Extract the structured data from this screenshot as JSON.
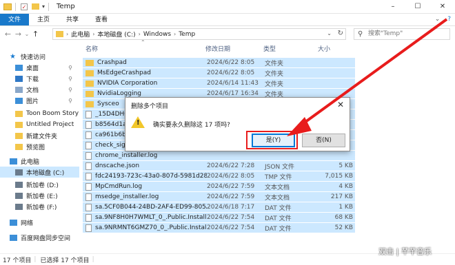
{
  "window": {
    "title": "Temp",
    "minimize": "–",
    "maximize": "☐",
    "close": "✕"
  },
  "ribbon": {
    "tabs": [
      "文件",
      "主页",
      "共享",
      "查看"
    ],
    "expand": "⌄",
    "help": "?"
  },
  "address": {
    "crumbs": [
      "此电脑",
      "本地磁盘 (C:)",
      "Windows",
      "Temp"
    ],
    "search_placeholder": "搜索\"Temp\""
  },
  "sidebar": {
    "items": [
      {
        "label": "快速访问",
        "icon": "star-icon",
        "color": "#1a7cd1"
      },
      {
        "label": "桌面",
        "icon": "desktop-icon",
        "color": "#3c8fd8",
        "pinned": true
      },
      {
        "label": "下载",
        "icon": "download-icon",
        "color": "#2f78c6",
        "pinned": true
      },
      {
        "label": "文档",
        "icon": "document-icon",
        "color": "#8aa7c9",
        "pinned": true
      },
      {
        "label": "图片",
        "icon": "picture-icon",
        "color": "#3c8fd8",
        "pinned": true
      },
      {
        "label": "Toon Boom Story",
        "icon": "folder-icon",
        "color": "#f3c64a"
      },
      {
        "label": "Untitled Project",
        "icon": "folder-icon",
        "color": "#f3c64a"
      },
      {
        "label": "新建文件夹",
        "icon": "folder-icon",
        "color": "#f3c64a"
      },
      {
        "label": "预览图",
        "icon": "folder-icon",
        "color": "#f3c64a"
      },
      {
        "label": "此电脑",
        "icon": "computer-icon",
        "color": "#3c8fd8"
      },
      {
        "label": "本地磁盘 (C:)",
        "icon": "drive-icon",
        "color": "#6b7b8c",
        "selected": true
      },
      {
        "label": "新加卷 (D:)",
        "icon": "drive-icon",
        "color": "#6b7b8c"
      },
      {
        "label": "新加卷 (E:)",
        "icon": "drive-icon",
        "color": "#6b7b8c"
      },
      {
        "label": "新加卷 (F:)",
        "icon": "drive-icon",
        "color": "#6b7b8c"
      },
      {
        "label": "网络",
        "icon": "network-icon",
        "color": "#3c8fd8"
      },
      {
        "label": "百度网盘同步空间",
        "icon": "cloud-icon",
        "color": "#3c8fd8"
      }
    ]
  },
  "columns": {
    "name": "名称",
    "date": "修改日期",
    "type": "类型",
    "size": "大小"
  },
  "files": [
    {
      "name": "Crashpad",
      "date": "2024/6/22 8:05",
      "type": "文件夹",
      "size": "",
      "kind": "folder"
    },
    {
      "name": "MsEdgeCrashpad",
      "date": "2024/6/22 8:05",
      "type": "文件夹",
      "size": "",
      "kind": "folder"
    },
    {
      "name": "NVIDIA Corporation",
      "date": "2024/6/14 11:43",
      "type": "文件夹",
      "size": "",
      "kind": "folder"
    },
    {
      "name": "NvidiaLogging",
      "date": "2024/6/17 16:34",
      "type": "文件夹",
      "size": "",
      "kind": "folder"
    },
    {
      "name": "Sysceo",
      "date": "",
      "type": "",
      "size": "",
      "kind": "folder"
    },
    {
      "name": "_15D4DHG",
      "date": "",
      "type": "",
      "size": "",
      "kind": "file"
    },
    {
      "name": "b8564d1a-",
      "date": "",
      "type": "",
      "size": "",
      "kind": "file"
    },
    {
      "name": "ca961b6b-",
      "date": "",
      "type": "",
      "size": "",
      "kind": "file"
    },
    {
      "name": "check_sign",
      "date": "",
      "type": "",
      "size": "",
      "kind": "file"
    },
    {
      "name": "chrome_installer.log",
      "date": "",
      "type": "",
      "size": "",
      "kind": "file"
    },
    {
      "name": "dnscache.json",
      "date": "2024/6/22 7:28",
      "type": "JSON 文件",
      "size": "5 KB",
      "kind": "file"
    },
    {
      "name": "fdc24193-723c-43a0-807d-5981d287...",
      "date": "2024/6/22 8:05",
      "type": "TMP 文件",
      "size": "7,015 KB",
      "kind": "file"
    },
    {
      "name": "MpCmdRun.log",
      "date": "2024/6/22 7:59",
      "type": "文本文档",
      "size": "4 KB",
      "kind": "file"
    },
    {
      "name": "msedge_installer.log",
      "date": "2024/6/22 7:59",
      "type": "文本文档",
      "size": "217 KB",
      "kind": "file"
    },
    {
      "name": "sa.5CF0B044-24BD-2AF4-ED99-805A...",
      "date": "2024/6/18 7:17",
      "type": "DAT 文件",
      "size": "1 KB",
      "kind": "file"
    },
    {
      "name": "sa.9NF8H0H7WMLT_0_.Public.Install...",
      "date": "2024/6/22 7:54",
      "type": "DAT 文件",
      "size": "68 KB",
      "kind": "file"
    },
    {
      "name": "sa.9NRMNT6GMZ70_0_.Public.Install...",
      "date": "2024/6/22 7:54",
      "type": "DAT 文件",
      "size": "52 KB",
      "kind": "file"
    }
  ],
  "status": {
    "count": "17 个项目",
    "selected": "已选择 17 个项目"
  },
  "dialog": {
    "title": "删除多个项目",
    "message": "确实要永久删除这 17 项吗?",
    "yes_label": "是(Y)",
    "no_label": "否(N)"
  },
  "watermark": "双击 | 芊芊音乐",
  "accent": "#0078d7",
  "annotation_color": "#e81c1c"
}
